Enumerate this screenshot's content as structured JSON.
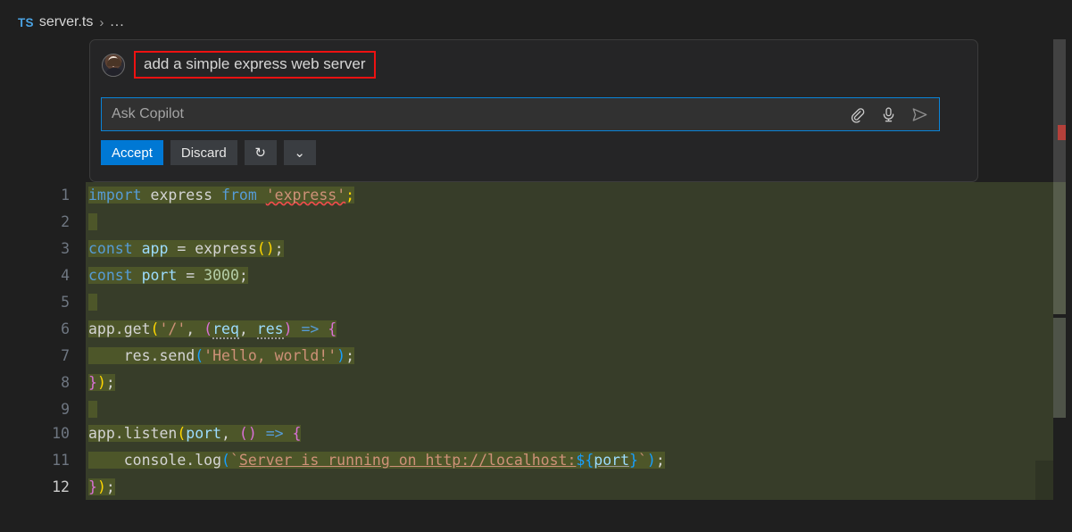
{
  "breadcrumb": {
    "file_type": "TS",
    "file_name": "server.ts",
    "separator": "›",
    "more": "..."
  },
  "copilot_panel": {
    "avatar_name": "user-avatar",
    "prompt": "add a simple express web server",
    "input": {
      "placeholder": "Ask Copilot",
      "value": ""
    },
    "input_icons": [
      {
        "name": "attach-icon",
        "label": "Attach context"
      },
      {
        "name": "microphone-icon",
        "label": "Voice input"
      },
      {
        "name": "send-icon",
        "label": "Send"
      }
    ],
    "buttons": {
      "accept": "Accept",
      "discard": "Discard",
      "regenerate": "↻",
      "more": "⌄"
    }
  },
  "editor": {
    "line_numbers": [
      "1",
      "2",
      "3",
      "4",
      "5",
      "6",
      "7",
      "8",
      "9",
      "10",
      "11",
      "12"
    ],
    "current_line": 12,
    "lines": [
      {
        "n": 1,
        "text": "import express from 'express';"
      },
      {
        "n": 2,
        "text": ""
      },
      {
        "n": 3,
        "text": "const app = express();"
      },
      {
        "n": 4,
        "text": "const port = 3000;"
      },
      {
        "n": 5,
        "text": ""
      },
      {
        "n": 6,
        "text": "app.get('/', (req, res) => {"
      },
      {
        "n": 7,
        "text": "    res.send('Hello, world!');"
      },
      {
        "n": 8,
        "text": "});"
      },
      {
        "n": 9,
        "text": ""
      },
      {
        "n": 10,
        "text": "app.listen(port, () => {"
      },
      {
        "n": 11,
        "text": "    console.log(`Server is running on http://localhost:${port}`);"
      },
      {
        "n": 12,
        "text": "});"
      }
    ],
    "language": "typescript",
    "diff_state": "inserted"
  },
  "colors": {
    "accent": "#0078d4",
    "highlight_box": "#ee1111",
    "diff_inserted_bg": "#373d29",
    "diff_inserted_text_bg": "#4d5629",
    "editor_bg": "#1f1f1f",
    "panel_bg": "#252526",
    "input_focus_border": "#0a84d8",
    "error_marker": "#b4403a"
  }
}
